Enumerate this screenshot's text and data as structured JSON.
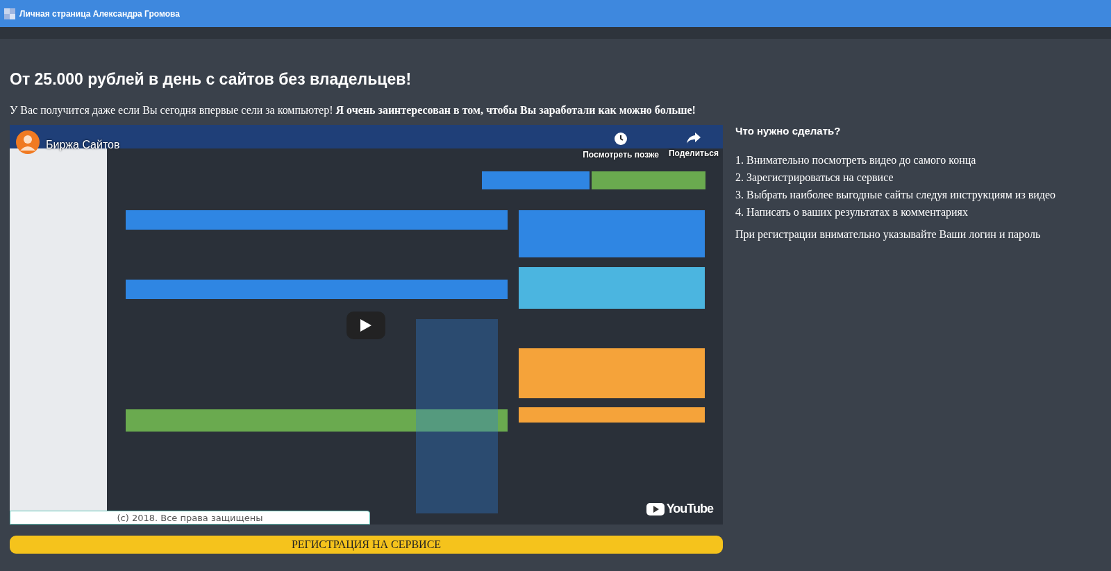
{
  "window": {
    "title": "Личная страница Александра Громова"
  },
  "headline": "От 25.000 рублей в день с сайтов без владельцев!",
  "intro": "У Вас получится даже если Вы сегодня впервые сели за компьютер! **Я очень заинтересован в том, чтобы Вы заработали как можно больше!**",
  "video": {
    "kind": "picture",
    "title": "Биржа Сайтов",
    "logo": "YouTube",
    "actions": [
      {
        "kind": "watch_later",
        "label": "Посмотреть позже"
      },
      {
        "kind": "share",
        "label": "Поделиться"
      }
    ]
  },
  "footer": "(c) 2018. Все права защищены",
  "steps": {
    "heading": "Что нужно сделать?",
    "items": [
      "1. Внимательно посмотреть видео до самого конца",
      "2. Зарегистрироваться на сервисе",
      "3. Выбрать наиболее выгодные сайты следуя инструкциям из видео",
      "4. Написать о ваших результатах в комментариях"
    ],
    "note": "При регистрации внимательно указывайте Ваши логин и пароль"
  },
  "register_button": "РЕГИСТРАЦИЯ НА СЕРВИСЕ"
}
